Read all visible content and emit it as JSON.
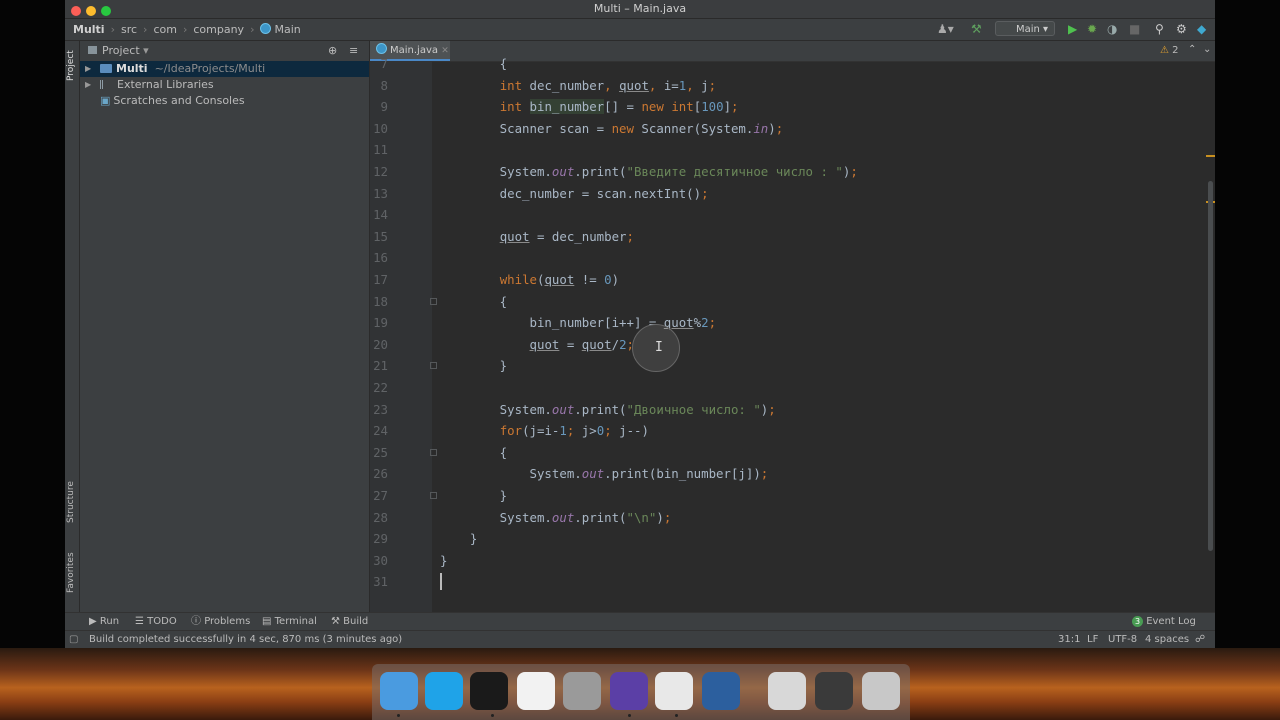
{
  "window": {
    "title": "Multi – Main.java"
  },
  "breadcrumbs": [
    "Multi",
    "src",
    "com",
    "company",
    "Main"
  ],
  "toolbar": {
    "run_config": "Main"
  },
  "project_panel": {
    "title": "Project",
    "tree": [
      {
        "label": "Multi",
        "path": "~/IdeaProjects/Multi"
      },
      {
        "label": "External Libraries"
      },
      {
        "label": "Scratches and Consoles"
      }
    ]
  },
  "left_stripe": {
    "project": "Project",
    "structure": "Structure",
    "favorites": "Favorites"
  },
  "editor": {
    "tab": "Main.java",
    "inspections": "2",
    "lines": [
      {
        "n": "7",
        "parts": [
          [
            "p",
            "        {"
          ]
        ]
      },
      {
        "n": "8",
        "parts": [
          [
            "p",
            "        "
          ],
          [
            "kw",
            "int"
          ],
          [
            "p",
            " dec_number"
          ],
          [
            "kw",
            ","
          ],
          [
            "p",
            " "
          ],
          [
            "ul",
            "quot"
          ],
          [
            "kw",
            ","
          ],
          [
            "p",
            " i="
          ],
          [
            "num",
            "1"
          ],
          [
            "kw",
            ","
          ],
          [
            "p",
            " j"
          ],
          [
            "kw",
            ";"
          ]
        ]
      },
      {
        "n": "9",
        "parts": [
          [
            "p",
            "        "
          ],
          [
            "kw",
            "int"
          ],
          [
            "p",
            " "
          ],
          [
            "hl",
            "bin_number"
          ],
          [
            "p",
            "[] = "
          ],
          [
            "kw",
            "new"
          ],
          [
            "p",
            " "
          ],
          [
            "kw",
            "int"
          ],
          [
            "p",
            "["
          ],
          [
            "num",
            "100"
          ],
          [
            "p",
            "]"
          ],
          [
            "kw",
            ";"
          ]
        ]
      },
      {
        "n": "10",
        "parts": [
          [
            "p",
            "        Scanner scan = "
          ],
          [
            "kw",
            "new"
          ],
          [
            "p",
            " Scanner(System."
          ],
          [
            "fld",
            "in"
          ],
          [
            "p",
            ")"
          ],
          [
            "kw",
            ";"
          ]
        ]
      },
      {
        "n": "11",
        "parts": []
      },
      {
        "n": "12",
        "parts": [
          [
            "p",
            "        System."
          ],
          [
            "fld",
            "out"
          ],
          [
            "p",
            ".print("
          ],
          [
            "str",
            "\"Введите десятичное число : \""
          ],
          [
            "p",
            ")"
          ],
          [
            "kw",
            ";"
          ]
        ]
      },
      {
        "n": "13",
        "parts": [
          [
            "p",
            "        dec_number = scan.nextInt()"
          ],
          [
            "kw",
            ";"
          ]
        ]
      },
      {
        "n": "14",
        "parts": []
      },
      {
        "n": "15",
        "parts": [
          [
            "p",
            "        "
          ],
          [
            "ul",
            "quot"
          ],
          [
            "p",
            " = dec_number"
          ],
          [
            "kw",
            ";"
          ]
        ]
      },
      {
        "n": "16",
        "parts": []
      },
      {
        "n": "17",
        "parts": [
          [
            "p",
            "        "
          ],
          [
            "kw",
            "while"
          ],
          [
            "p",
            "("
          ],
          [
            "ul",
            "quot"
          ],
          [
            "p",
            " != "
          ],
          [
            "num",
            "0"
          ],
          [
            "p",
            ")"
          ]
        ]
      },
      {
        "n": "18",
        "parts": [
          [
            "p",
            "        {"
          ]
        ]
      },
      {
        "n": "19",
        "parts": [
          [
            "p",
            "            bin_number[i++] = "
          ],
          [
            "ul",
            "quot"
          ],
          [
            "p",
            "%"
          ],
          [
            "num",
            "2"
          ],
          [
            "kw",
            ";"
          ]
        ]
      },
      {
        "n": "20",
        "parts": [
          [
            "p",
            "            "
          ],
          [
            "ul",
            "quot"
          ],
          [
            "p",
            " = "
          ],
          [
            "ul",
            "quot"
          ],
          [
            "p",
            "/"
          ],
          [
            "num",
            "2"
          ],
          [
            "kw",
            ";"
          ]
        ]
      },
      {
        "n": "21",
        "parts": [
          [
            "p",
            "        }"
          ]
        ]
      },
      {
        "n": "22",
        "parts": []
      },
      {
        "n": "23",
        "parts": [
          [
            "p",
            "        System."
          ],
          [
            "fld",
            "out"
          ],
          [
            "p",
            ".print("
          ],
          [
            "str",
            "\"Двоичное число: \""
          ],
          [
            "p",
            ")"
          ],
          [
            "kw",
            ";"
          ]
        ]
      },
      {
        "n": "24",
        "parts": [
          [
            "p",
            "        "
          ],
          [
            "kw",
            "for"
          ],
          [
            "p",
            "(j=i-"
          ],
          [
            "num",
            "1"
          ],
          [
            "kw",
            ";"
          ],
          [
            "p",
            " j>"
          ],
          [
            "num",
            "0"
          ],
          [
            "kw",
            ";"
          ],
          [
            "p",
            " j--)"
          ]
        ]
      },
      {
        "n": "25",
        "parts": [
          [
            "p",
            "        {"
          ]
        ]
      },
      {
        "n": "26",
        "parts": [
          [
            "p",
            "            System."
          ],
          [
            "fld",
            "out"
          ],
          [
            "p",
            ".print(bin_number[j])"
          ],
          [
            "kw",
            ";"
          ]
        ]
      },
      {
        "n": "27",
        "parts": [
          [
            "p",
            "        }"
          ]
        ]
      },
      {
        "n": "28",
        "parts": [
          [
            "p",
            "        System."
          ],
          [
            "fld",
            "out"
          ],
          [
            "p",
            ".print("
          ],
          [
            "str",
            "\"\\n\""
          ],
          [
            "p",
            ")"
          ],
          [
            "kw",
            ";"
          ]
        ]
      },
      {
        "n": "29",
        "parts": [
          [
            "p",
            "    }"
          ]
        ]
      },
      {
        "n": "30",
        "parts": [
          [
            "p",
            "}"
          ]
        ]
      },
      {
        "n": "31",
        "parts": []
      }
    ]
  },
  "tool_windows": [
    "Run",
    "TODO",
    "Problems",
    "Terminal",
    "Build"
  ],
  "event_log": {
    "count": "3",
    "label": "Event Log"
  },
  "status": {
    "message": "Build completed successfully in 4 sec, 870 ms (3 minutes ago)",
    "position": "31:1",
    "line_sep": "LF",
    "encoding": "UTF-8",
    "indent": "4 spaces"
  },
  "dock_apps": [
    "Finder",
    "Skype",
    "IntelliJ IDEA",
    "Text Document",
    "System Preferences",
    "iMovie",
    "Chrome",
    "QuickTime",
    "Keyboard",
    "Screenshot",
    "Trash"
  ],
  "colors": {
    "keyword": "#cc7832",
    "number": "#6897bb",
    "string": "#6a8759",
    "field": "#9876aa",
    "text": "#a9b7c6",
    "accent": "#4a88c7"
  }
}
